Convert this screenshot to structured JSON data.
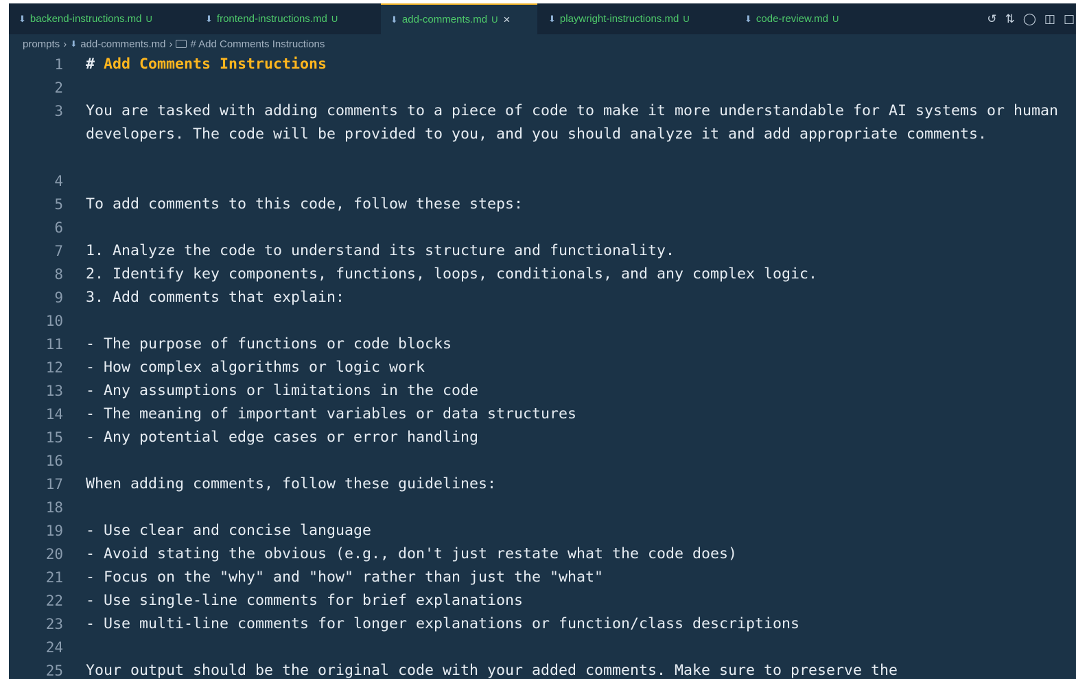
{
  "tabs": [
    {
      "label": "backend-instructions.md",
      "status": "U",
      "active": false
    },
    {
      "label": "frontend-instructions.md",
      "status": "U",
      "active": false
    },
    {
      "label": "add-comments.md",
      "status": "U",
      "active": true
    },
    {
      "label": "playwright-instructions.md",
      "status": "U",
      "active": false
    },
    {
      "label": "code-review.md",
      "status": "U",
      "active": false
    }
  ],
  "tab_icons": {
    "file_icon": "markdown-download-icon",
    "close_glyph": "×"
  },
  "tab_actions": [
    "history-icon",
    "source-control-icon",
    "chat-icon",
    "split-editor-icon",
    "layout-icon"
  ],
  "breadcrumb": {
    "folder": "prompts",
    "file": "add-comments.md",
    "symbol": "# Add Comments Instructions"
  },
  "editor": {
    "lines": [
      {
        "n": "1",
        "text": "Add Comments Instructions",
        "heading": true,
        "prefix": "# "
      },
      {
        "n": "2",
        "text": ""
      },
      {
        "n": "3",
        "text": "You are tasked with adding comments to a piece of code to make it more understandable for AI systems or human developers. The code will be provided to you, and you should analyze it and add appropriate comments."
      },
      {
        "n": "4",
        "text": ""
      },
      {
        "n": "5",
        "text": "To add comments to this code, follow these steps:"
      },
      {
        "n": "6",
        "text": ""
      },
      {
        "n": "7",
        "text": "1. Analyze the code to understand its structure and functionality."
      },
      {
        "n": "8",
        "text": "2. Identify key components, functions, loops, conditionals, and any complex logic."
      },
      {
        "n": "9",
        "text": "3. Add comments that explain:"
      },
      {
        "n": "10",
        "text": ""
      },
      {
        "n": "11",
        "text": "- The purpose of functions or code blocks"
      },
      {
        "n": "12",
        "text": "- How complex algorithms or logic work"
      },
      {
        "n": "13",
        "text": "- Any assumptions or limitations in the code"
      },
      {
        "n": "14",
        "text": "- The meaning of important variables or data structures"
      },
      {
        "n": "15",
        "text": "- Any potential edge cases or error handling"
      },
      {
        "n": "16",
        "text": ""
      },
      {
        "n": "17",
        "text": "When adding comments, follow these guidelines:"
      },
      {
        "n": "18",
        "text": ""
      },
      {
        "n": "19",
        "text": "- Use clear and concise language"
      },
      {
        "n": "20",
        "text": "- Avoid stating the obvious (e.g., don't just restate what the code does)"
      },
      {
        "n": "21",
        "text": "- Focus on the \"why\" and \"how\" rather than just the \"what\""
      },
      {
        "n": "22",
        "text": "- Use single-line comments for brief explanations"
      },
      {
        "n": "23",
        "text": "- Use multi-line comments for longer explanations or function/class descriptions"
      },
      {
        "n": "24",
        "text": ""
      },
      {
        "n": "25",
        "text": "Your output should be the original code with your added comments. Make sure to preserve the"
      }
    ]
  },
  "colors": {
    "editor_bg": "#1b3347",
    "tabbar_bg": "#152638",
    "heading": "#ffb61e",
    "untracked": "#4ec96a",
    "active_tab_border": "#f0b429"
  }
}
